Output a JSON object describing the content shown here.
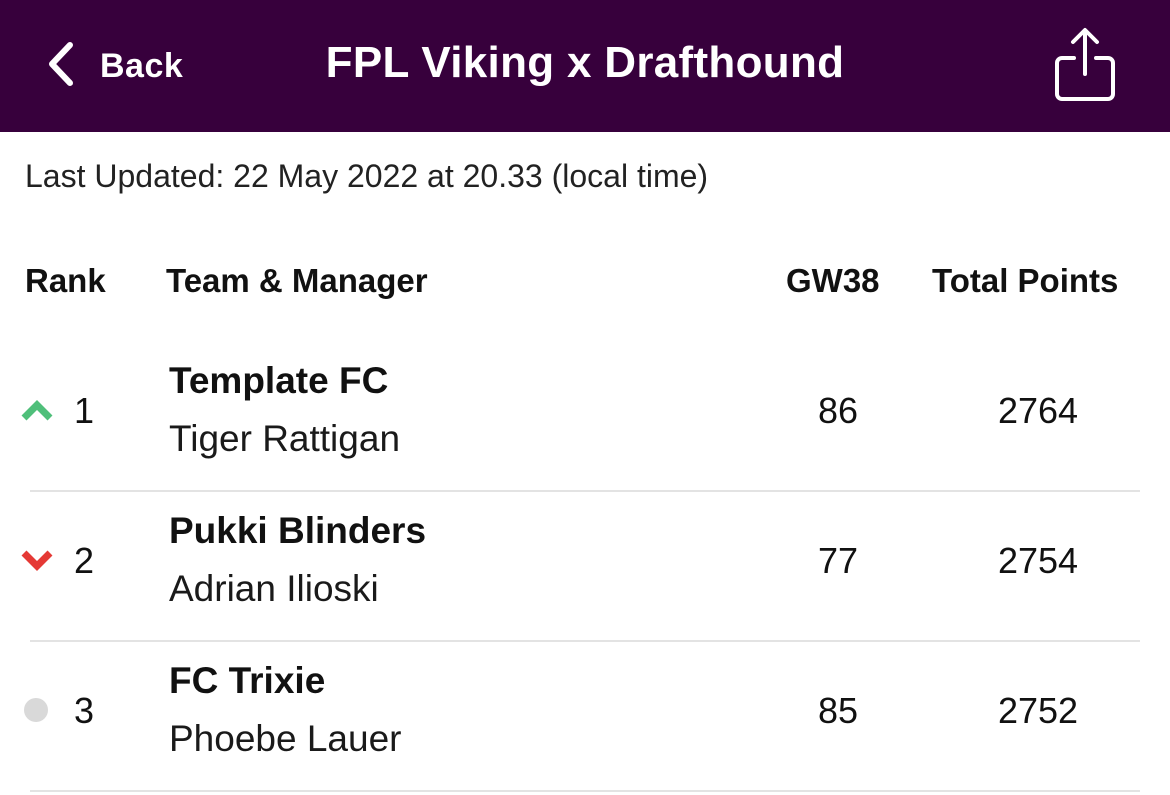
{
  "header": {
    "back_label": "Back",
    "title": "FPL Viking x Drafthound",
    "background_color": "#37003c",
    "back_icon": "chevron-left-icon",
    "share_icon": "share-icon"
  },
  "last_updated": "Last Updated: 22 May 2022 at 20.33 (local time)",
  "table": {
    "columns": {
      "rank": "Rank",
      "team": "Team & Manager",
      "gw": "GW38",
      "total": "Total Points"
    },
    "rows": [
      {
        "rank": "1",
        "movement": "up",
        "team": "Template FC",
        "manager": "Tiger Rattigan",
        "gw": "86",
        "total": "2764"
      },
      {
        "rank": "2",
        "movement": "down",
        "team": "Pukki Blinders",
        "manager": "Adrian Ilioski",
        "gw": "77",
        "total": "2754"
      },
      {
        "rank": "3",
        "movement": "same",
        "team": "FC Trixie",
        "manager": "Phoebe Lauer",
        "gw": "85",
        "total": "2752"
      }
    ]
  },
  "colors": {
    "up": "#4fbf7a",
    "down": "#e53935",
    "same": "#d9d9d9"
  }
}
